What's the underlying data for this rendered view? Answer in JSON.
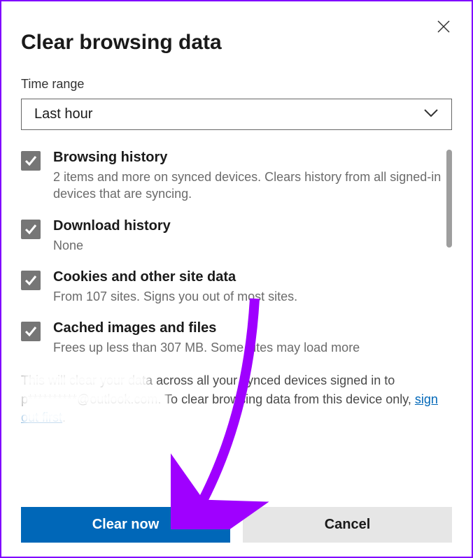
{
  "dialog": {
    "title": "Clear browsing data",
    "time_range_label": "Time range",
    "time_range_value": "Last hour"
  },
  "items": [
    {
      "title": "Browsing history",
      "desc": "2 items and more on synced devices. Clears history from all signed-in devices that are syncing.",
      "checked": true
    },
    {
      "title": "Download history",
      "desc": "None",
      "checked": true
    },
    {
      "title": "Cookies and other site data",
      "desc": "From 107 sites. Signs you out of most sites.",
      "checked": true
    },
    {
      "title": "Cached images and files",
      "desc": "Frees up less than 307 MB. Some sites may load more",
      "checked": true
    }
  ],
  "info": {
    "part1": "This will clear your data across all your synced devices signed in to ",
    "part2": "p**********@outlook.com. To clear browsing data from this device only, ",
    "link": "sign out first",
    "part3": "."
  },
  "buttons": {
    "primary": "Clear now",
    "secondary": "Cancel"
  },
  "colors": {
    "accent": "#0067b8",
    "border": "#8000ff"
  }
}
